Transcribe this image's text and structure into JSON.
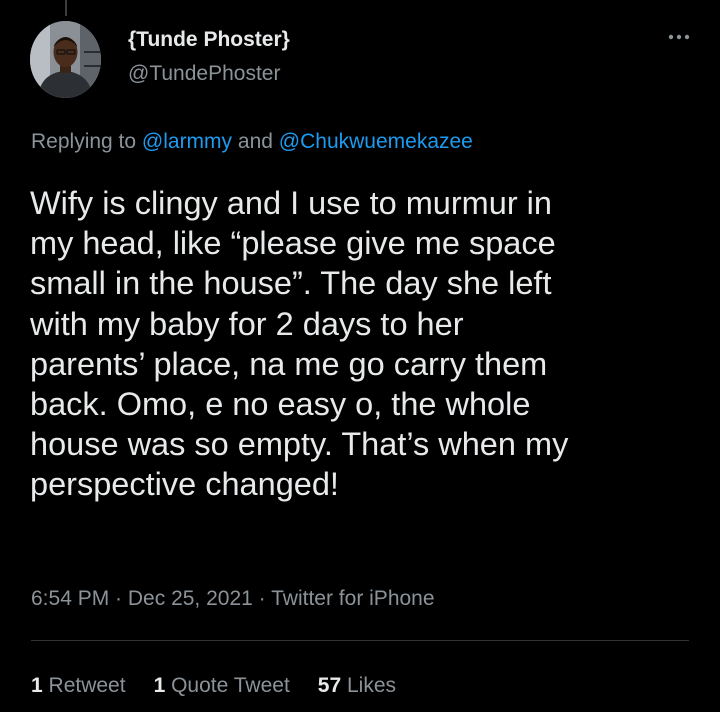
{
  "author": {
    "display_name": "{Tunde Phoster}",
    "handle": "@TundePhoster",
    "avatar_icon": "profile-photo"
  },
  "more_icon": "more-horizontal-icon",
  "reply": {
    "prefix": "Replying to ",
    "mention_1": "@larmmy",
    "joiner": " and ",
    "mention_2": "@Chukwuemekazee"
  },
  "tweet": {
    "lines": [
      "Wify is clingy and I use to murmur in",
      "my head, like “please give me space",
      "small in the house”. The day she left",
      "with my baby for 2 days to her",
      "parents’ place, na me go carry them",
      "back. Omo, e no easy o, the whole",
      "house was so empty. That’s when my",
      "perspective changed!"
    ]
  },
  "meta": {
    "time": "6:54 PM",
    "separator": " · ",
    "date": "Dec 25, 2021",
    "source": "Twitter for iPhone"
  },
  "stats": {
    "retweets_count": "1",
    "retweets_label": " Retweet",
    "quotes_count": "1",
    "quotes_label": " Quote Tweet",
    "likes_count": "57",
    "likes_label": " Likes"
  },
  "colors": {
    "background": "#000000",
    "text": "#e7e9ea",
    "secondary": "#8b9298",
    "link": "#1d9bf0",
    "divider": "#2f3336"
  }
}
